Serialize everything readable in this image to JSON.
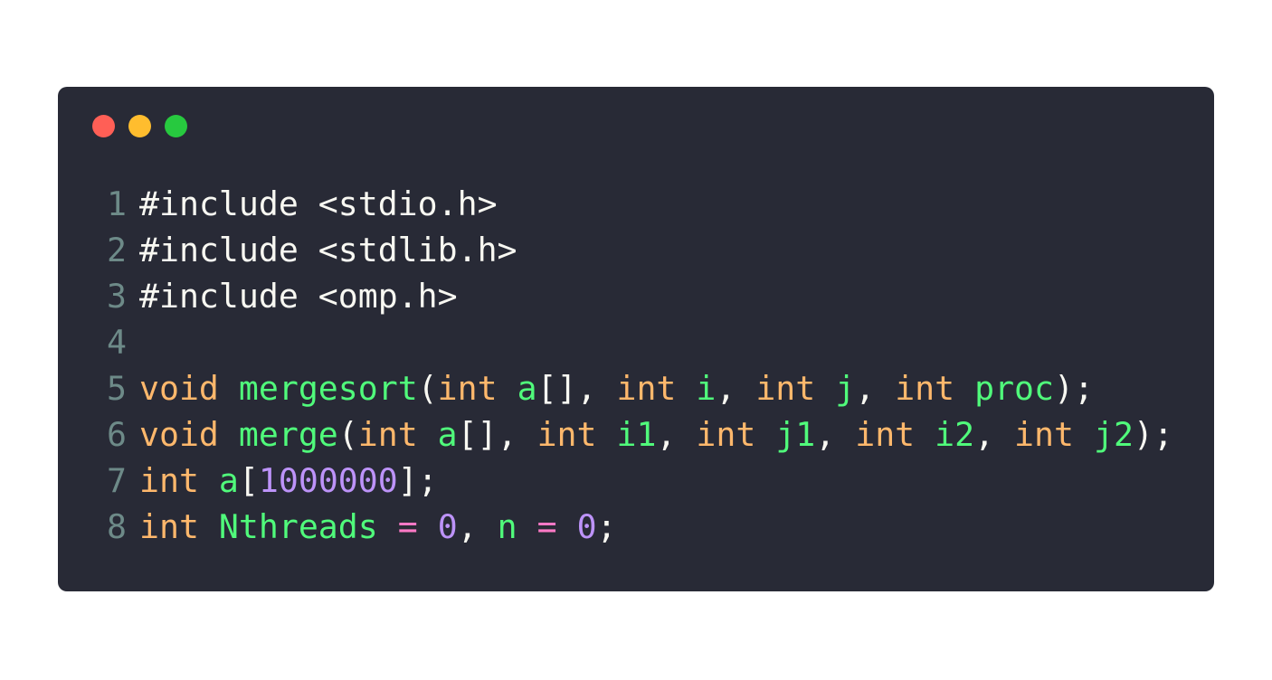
{
  "colors": {
    "background": "#282a36",
    "line_number": "#6d8a88",
    "plain": "#f8f8f2",
    "type": "#ffb86c",
    "identifier": "#50fa7b",
    "number": "#bd93f9",
    "operator": "#ff79c6",
    "traffic_red": "#ff5f56",
    "traffic_yellow": "#ffbd2e",
    "traffic_green": "#27c93f"
  },
  "window_controls": [
    {
      "name": "close",
      "color": "#ff5f56"
    },
    {
      "name": "minimize",
      "color": "#ffbd2e"
    },
    {
      "name": "maximize",
      "color": "#27c93f"
    }
  ],
  "code": {
    "lines": [
      {
        "number": "1",
        "tokens": [
          {
            "t": "#include <stdio.h>",
            "c": "plain"
          }
        ]
      },
      {
        "number": "2",
        "tokens": [
          {
            "t": "#include <stdlib.h>",
            "c": "plain"
          }
        ]
      },
      {
        "number": "3",
        "tokens": [
          {
            "t": "#include <omp.h>",
            "c": "plain"
          }
        ]
      },
      {
        "number": "4",
        "tokens": []
      },
      {
        "number": "5",
        "tokens": [
          {
            "t": "void",
            "c": "type"
          },
          {
            "t": " ",
            "c": "plain"
          },
          {
            "t": "mergesort",
            "c": "identifier"
          },
          {
            "t": "(",
            "c": "plain"
          },
          {
            "t": "int",
            "c": "type"
          },
          {
            "t": " ",
            "c": "plain"
          },
          {
            "t": "a",
            "c": "identifier"
          },
          {
            "t": "[], ",
            "c": "plain"
          },
          {
            "t": "int",
            "c": "type"
          },
          {
            "t": " ",
            "c": "plain"
          },
          {
            "t": "i",
            "c": "identifier"
          },
          {
            "t": ", ",
            "c": "plain"
          },
          {
            "t": "int",
            "c": "type"
          },
          {
            "t": " ",
            "c": "plain"
          },
          {
            "t": "j",
            "c": "identifier"
          },
          {
            "t": ", ",
            "c": "plain"
          },
          {
            "t": "int",
            "c": "type"
          },
          {
            "t": " ",
            "c": "plain"
          },
          {
            "t": "proc",
            "c": "identifier"
          },
          {
            "t": ");",
            "c": "plain"
          }
        ]
      },
      {
        "number": "6",
        "tokens": [
          {
            "t": "void",
            "c": "type"
          },
          {
            "t": " ",
            "c": "plain"
          },
          {
            "t": "merge",
            "c": "identifier"
          },
          {
            "t": "(",
            "c": "plain"
          },
          {
            "t": "int",
            "c": "type"
          },
          {
            "t": " ",
            "c": "plain"
          },
          {
            "t": "a",
            "c": "identifier"
          },
          {
            "t": "[], ",
            "c": "plain"
          },
          {
            "t": "int",
            "c": "type"
          },
          {
            "t": " ",
            "c": "plain"
          },
          {
            "t": "i1",
            "c": "identifier"
          },
          {
            "t": ", ",
            "c": "plain"
          },
          {
            "t": "int",
            "c": "type"
          },
          {
            "t": " ",
            "c": "plain"
          },
          {
            "t": "j1",
            "c": "identifier"
          },
          {
            "t": ", ",
            "c": "plain"
          },
          {
            "t": "int",
            "c": "type"
          },
          {
            "t": " ",
            "c": "plain"
          },
          {
            "t": "i2",
            "c": "identifier"
          },
          {
            "t": ", ",
            "c": "plain"
          },
          {
            "t": "int",
            "c": "type"
          },
          {
            "t": " ",
            "c": "plain"
          },
          {
            "t": "j2",
            "c": "identifier"
          },
          {
            "t": ");",
            "c": "plain"
          }
        ]
      },
      {
        "number": "7",
        "tokens": [
          {
            "t": "int",
            "c": "type"
          },
          {
            "t": " ",
            "c": "plain"
          },
          {
            "t": "a",
            "c": "identifier"
          },
          {
            "t": "[",
            "c": "plain"
          },
          {
            "t": "1000000",
            "c": "number"
          },
          {
            "t": "];",
            "c": "plain"
          }
        ]
      },
      {
        "number": "8",
        "tokens": [
          {
            "t": "int",
            "c": "type"
          },
          {
            "t": " ",
            "c": "plain"
          },
          {
            "t": "Nthreads",
            "c": "identifier"
          },
          {
            "t": " ",
            "c": "plain"
          },
          {
            "t": "=",
            "c": "operator"
          },
          {
            "t": " ",
            "c": "plain"
          },
          {
            "t": "0",
            "c": "number"
          },
          {
            "t": ", ",
            "c": "plain"
          },
          {
            "t": "n",
            "c": "identifier"
          },
          {
            "t": " ",
            "c": "plain"
          },
          {
            "t": "=",
            "c": "operator"
          },
          {
            "t": " ",
            "c": "plain"
          },
          {
            "t": "0",
            "c": "number"
          },
          {
            "t": ";",
            "c": "plain"
          }
        ]
      }
    ]
  }
}
